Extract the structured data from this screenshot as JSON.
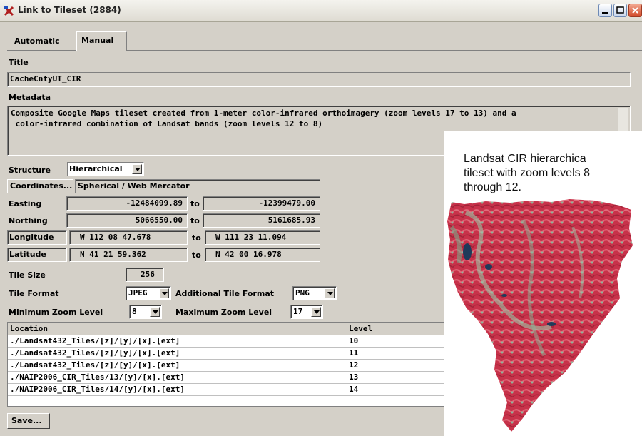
{
  "window": {
    "title": "Link to Tileset (2884)"
  },
  "tabs": [
    {
      "label": "Automatic"
    },
    {
      "label": "Manual"
    }
  ],
  "title_section": {
    "label": "Title",
    "value": "CacheCntyUT_CIR"
  },
  "metadata": {
    "label": "Metadata",
    "lines": [
      "Composite Google Maps tileset created from 1-meter color-infrared orthoimagery (zoom levels 17 to 13) and a",
      " color-infrared combination of Landsat bands (zoom levels 12 to 8)"
    ]
  },
  "structure": {
    "label": "Structure",
    "value": "Hierarchical"
  },
  "coordinates": {
    "button_label": "Coordinates...",
    "value": "Spherical / Web Mercator"
  },
  "easting": {
    "label": "Easting",
    "from": "-12484099.89",
    "to_label": "to",
    "to": "-12399479.00"
  },
  "northing": {
    "label": "Northing",
    "from": "5066550.00",
    "to_label": "to",
    "to": "5161685.93"
  },
  "longitude": {
    "label": "Longitude",
    "from": "W 112 08 47.678",
    "to_label": "to",
    "to": "W 111 23 11.094"
  },
  "latitude": {
    "label": "Latitude",
    "from": "N 41 21 59.362",
    "to_label": "to",
    "to": "N 42 00 16.978"
  },
  "tile_size": {
    "label": "Tile Size",
    "value": "256"
  },
  "tile_format": {
    "label": "Tile Format",
    "value": "JPEG",
    "additional_label": "Additional Tile Format",
    "additional_value": "PNG"
  },
  "zoom": {
    "min_label": "Minimum Zoom Level",
    "min_value": "8",
    "max_label": "Maximum Zoom Level",
    "max_value": "17"
  },
  "table": {
    "headers": [
      "Location",
      "Level"
    ],
    "rows": [
      {
        "location": "./Landsat432_Tiles/[z]/[y]/[x].[ext]",
        "level": "10"
      },
      {
        "location": "./Landsat432_Tiles/[z]/[y]/[x].[ext]",
        "level": "11"
      },
      {
        "location": "./Landsat432_Tiles/[z]/[y]/[x].[ext]",
        "level": "12"
      },
      {
        "location": "./NAIP2006_CIR_Tiles/13/[y]/[x].[ext]",
        "level": "13"
      },
      {
        "location": "./NAIP2006_CIR_Tiles/14/[y]/[x].[ext]",
        "level": "14"
      }
    ]
  },
  "save_button": {
    "label": "Save..."
  },
  "annotation": {
    "text": "Landsat CIR hierarchica\ntileset with zoom levels 8\nthrough 12."
  },
  "colors": {
    "window_bg": "#d4d0c8",
    "image_red": "#c8324a",
    "image_green": "#7aa88a"
  }
}
